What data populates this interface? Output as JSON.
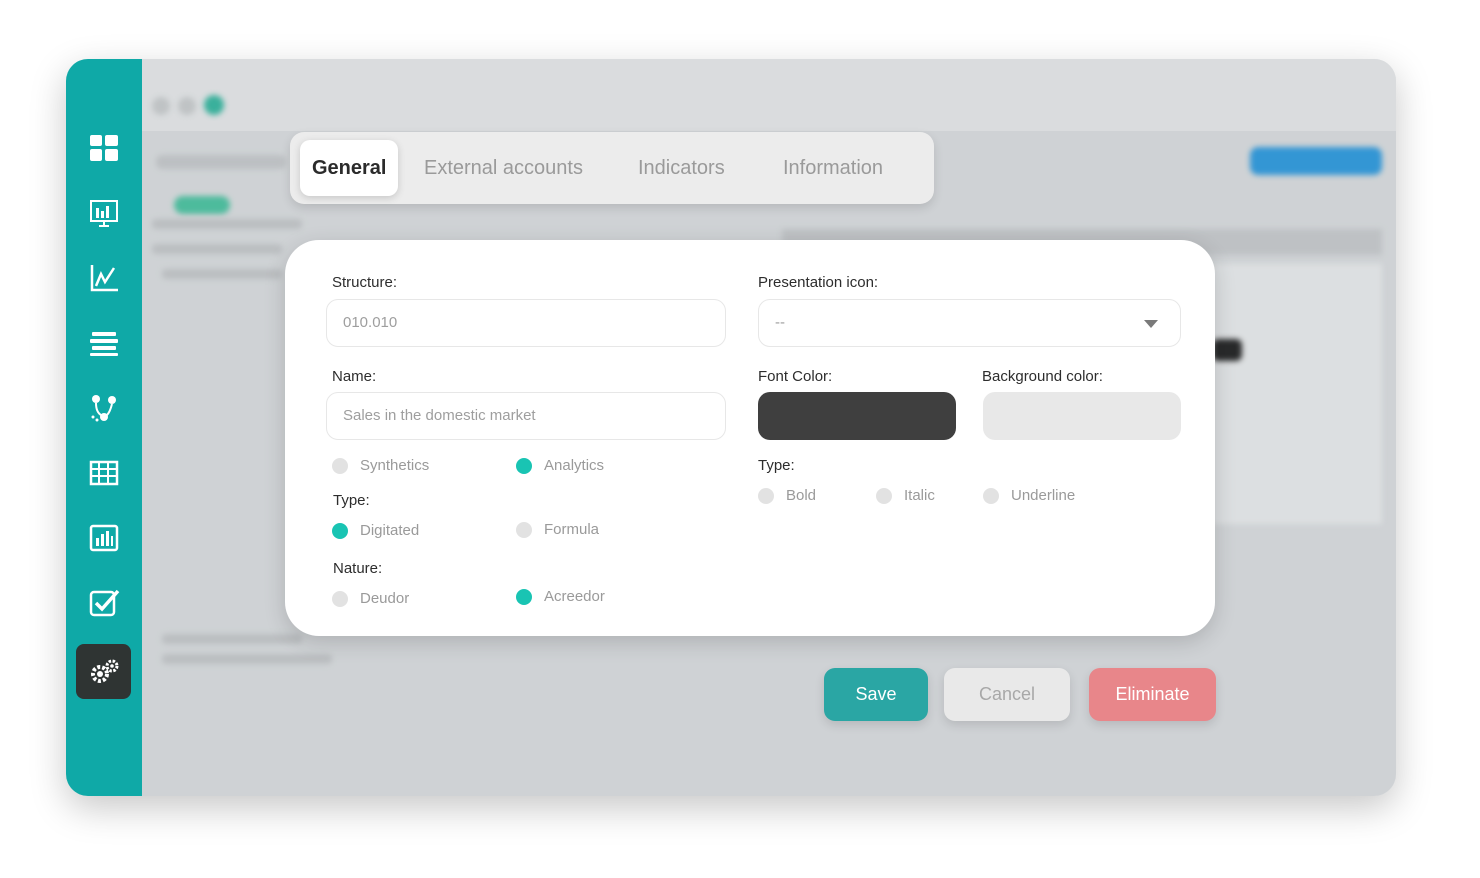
{
  "sidebar": {
    "items": [
      {
        "icon": "dashboard-icon"
      },
      {
        "icon": "presentation-chart-icon"
      },
      {
        "icon": "line-chart-icon"
      },
      {
        "icon": "layers-stack-icon"
      },
      {
        "icon": "flow-diagram-icon"
      },
      {
        "icon": "table-grid-icon"
      },
      {
        "icon": "bar-chart-icon"
      },
      {
        "icon": "checkbox-check-icon"
      },
      {
        "icon": "settings-gears-icon",
        "active": true
      }
    ]
  },
  "tabs": [
    {
      "label": "General",
      "active": true
    },
    {
      "label": "External accounts"
    },
    {
      "label": "Indicators"
    },
    {
      "label": "Information"
    }
  ],
  "form": {
    "structure_label": "Structure:",
    "structure_value": "010.010",
    "name_label": "Name:",
    "name_placeholder": "Sales in the domestic market",
    "level_options": [
      {
        "label": "Synthetics",
        "selected": false
      },
      {
        "label": "Analytics",
        "selected": true
      }
    ],
    "type_label": "Type:",
    "type_options": [
      {
        "label": "Digitated",
        "selected": true
      },
      {
        "label": "Formula",
        "selected": false
      }
    ],
    "nature_label": "Nature:",
    "nature_options": [
      {
        "label": "Deudor",
        "selected": false
      },
      {
        "label": "Acreedor",
        "selected": true
      }
    ],
    "presentation_icon_label": "Presentation icon:",
    "presentation_icon_value": "--",
    "font_color_label": "Font Color:",
    "font_color": "#3f3f3f",
    "background_color_label": "Background color:",
    "background_color": "#e8e8e8",
    "style_type_label": "Type:",
    "style_options": [
      {
        "label": "Bold",
        "selected": false
      },
      {
        "label": "Italic",
        "selected": false
      },
      {
        "label": "Underline",
        "selected": false
      }
    ]
  },
  "buttons": {
    "save": "Save",
    "cancel": "Cancel",
    "eliminate": "Eliminate"
  },
  "colors": {
    "accent": "#0fa9a7",
    "save": "#2aa6a4",
    "cancel": "#e9e9e9",
    "eliminate": "#e8868a",
    "radio_on": "#19c4b3"
  }
}
